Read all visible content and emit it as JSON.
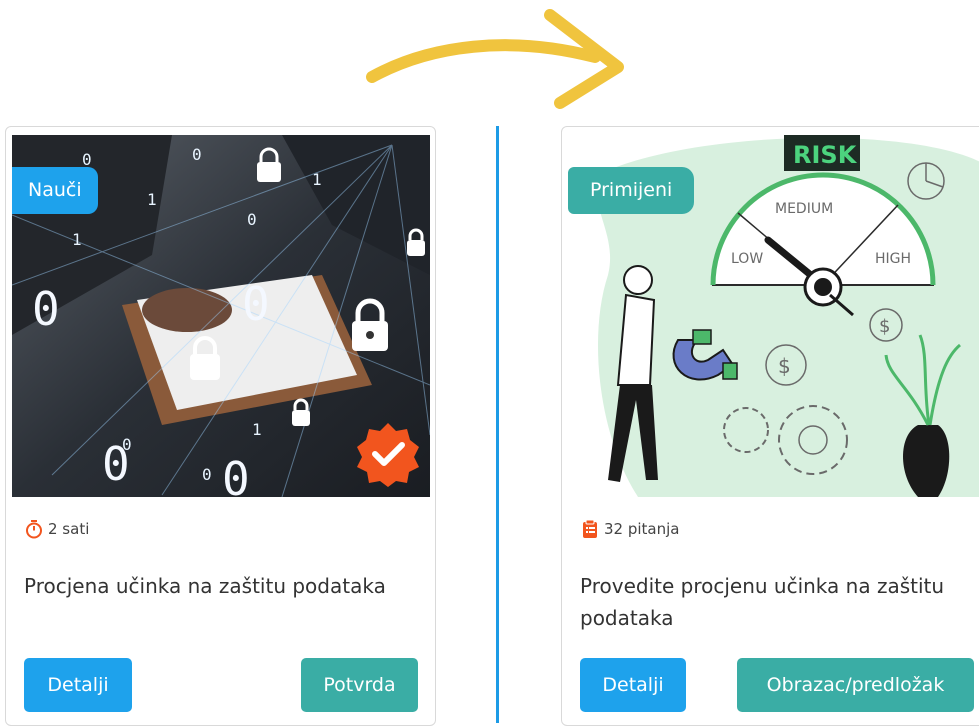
{
  "cards": [
    {
      "badge": "Nauči",
      "meta": "2 sati",
      "title": "Procjena učinka na zaštitu podataka",
      "buttons": {
        "details": "Detalji",
        "action": "Potvrda"
      }
    },
    {
      "badge": "Primijeni",
      "meta": "32 pitanja",
      "title": "Provedite procjenu učinka na zaštitu podataka",
      "buttons": {
        "details": "Detalji",
        "action": "Obrazac/predložak"
      }
    }
  ],
  "illustration": {
    "risk_label": "RISK",
    "gauge_labels": [
      "LOW",
      "MEDIUM",
      "HIGH"
    ]
  },
  "colors": {
    "learn_accent": "#1ea2ec",
    "apply_accent": "#3aada5",
    "arrow": "#f0c43e",
    "divider": "#1d9be6",
    "check_badge": "#f2551e",
    "meta_icon": "#f2551e"
  }
}
